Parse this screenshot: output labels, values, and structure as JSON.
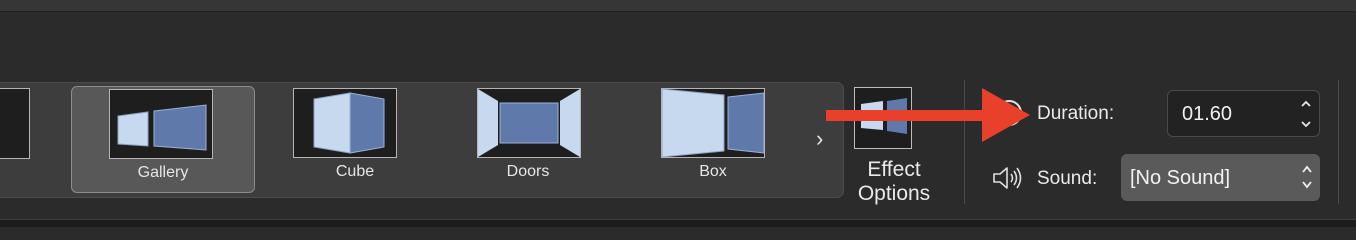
{
  "transitions": {
    "items": [
      {
        "label": "Gallery",
        "selected": true,
        "icon": "gallery-transition-icon"
      },
      {
        "label": "Cube",
        "selected": false,
        "icon": "cube-transition-icon"
      },
      {
        "label": "Doors",
        "selected": false,
        "icon": "doors-transition-icon"
      },
      {
        "label": "Box",
        "selected": false,
        "icon": "box-transition-icon"
      }
    ],
    "next_icon": "chevron-right-icon"
  },
  "effect_options": {
    "label_line1": "Effect",
    "label_line2": "Options",
    "icon": "effect-options-icon"
  },
  "timing": {
    "duration_label": "Duration:",
    "duration_value": "01.60",
    "sound_label": "Sound:",
    "sound_value": "[No Sound]"
  },
  "annotation": {
    "color": "#e8402b",
    "icon": "red-arrow-annotation"
  },
  "colors": {
    "background": "#2b2b2b",
    "gallery_bg": "#3d3d3d",
    "selected_bg": "#585858",
    "slide_light": "#c7d9ef",
    "slide_dark": "#6079ab"
  }
}
